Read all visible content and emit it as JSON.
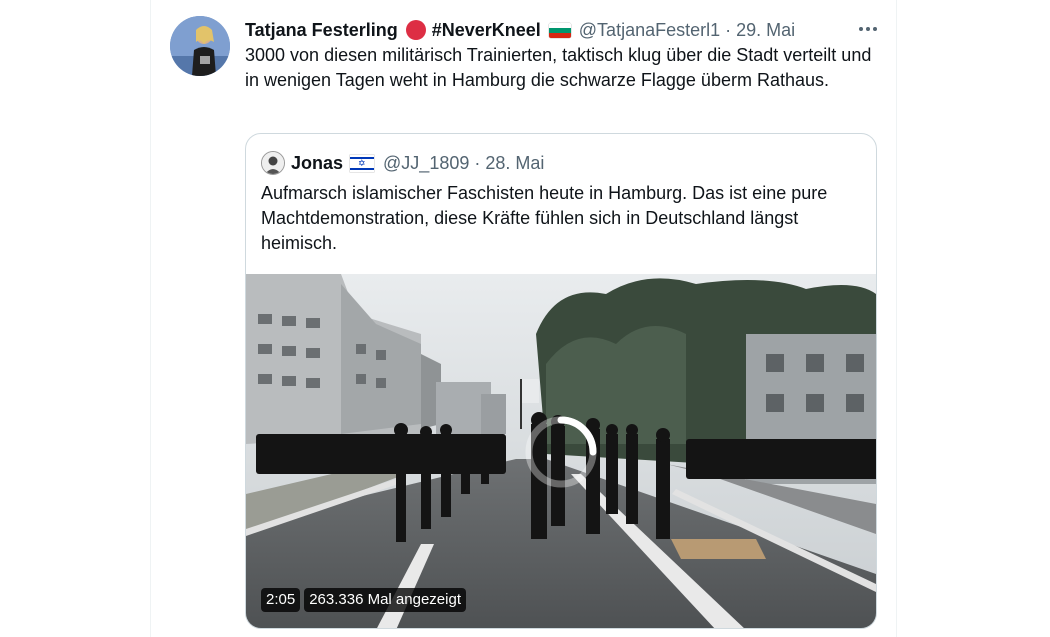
{
  "tweet": {
    "author_name": "Tatjana Festerling",
    "hashtag": "#NeverKneel",
    "handle": "@TatjanaFesterl1",
    "separator": "·",
    "date": "29. Mai",
    "text": "3000 von diesen militärisch Trainierten, taktisch klug über die Stadt verteilt und in wenigen Tagen weht in Hamburg die schwarze Flagge überm Rathaus.",
    "icons": [
      "red-circle-icon",
      "bulgaria-flag-icon",
      "more-options-icon"
    ],
    "colors": {
      "red_circle": "#dd2e44",
      "flag_white": "#ffffff",
      "flag_green": "#00966e",
      "flag_red": "#d62612"
    }
  },
  "quoted_tweet": {
    "author_name": "Jonas",
    "handle": "@JJ_1809",
    "separator": "·",
    "date": "28. Mai",
    "text": "Aufmarsch islamischer Faschisten heute in Hamburg. Das ist eine pure Machtdemonstration, diese Kräfte fühlen sich in Deutschland längst heimisch.",
    "icons": [
      "israel-flag-icon"
    ],
    "colors": {
      "flag_blue": "#0038b8"
    },
    "video": {
      "duration": "2:05",
      "views": "263.336 Mal angezeigt",
      "state": "loading"
    }
  },
  "theme": {
    "text": "#0f1419",
    "secondary_text": "#536471",
    "border": "#cfd9de"
  }
}
